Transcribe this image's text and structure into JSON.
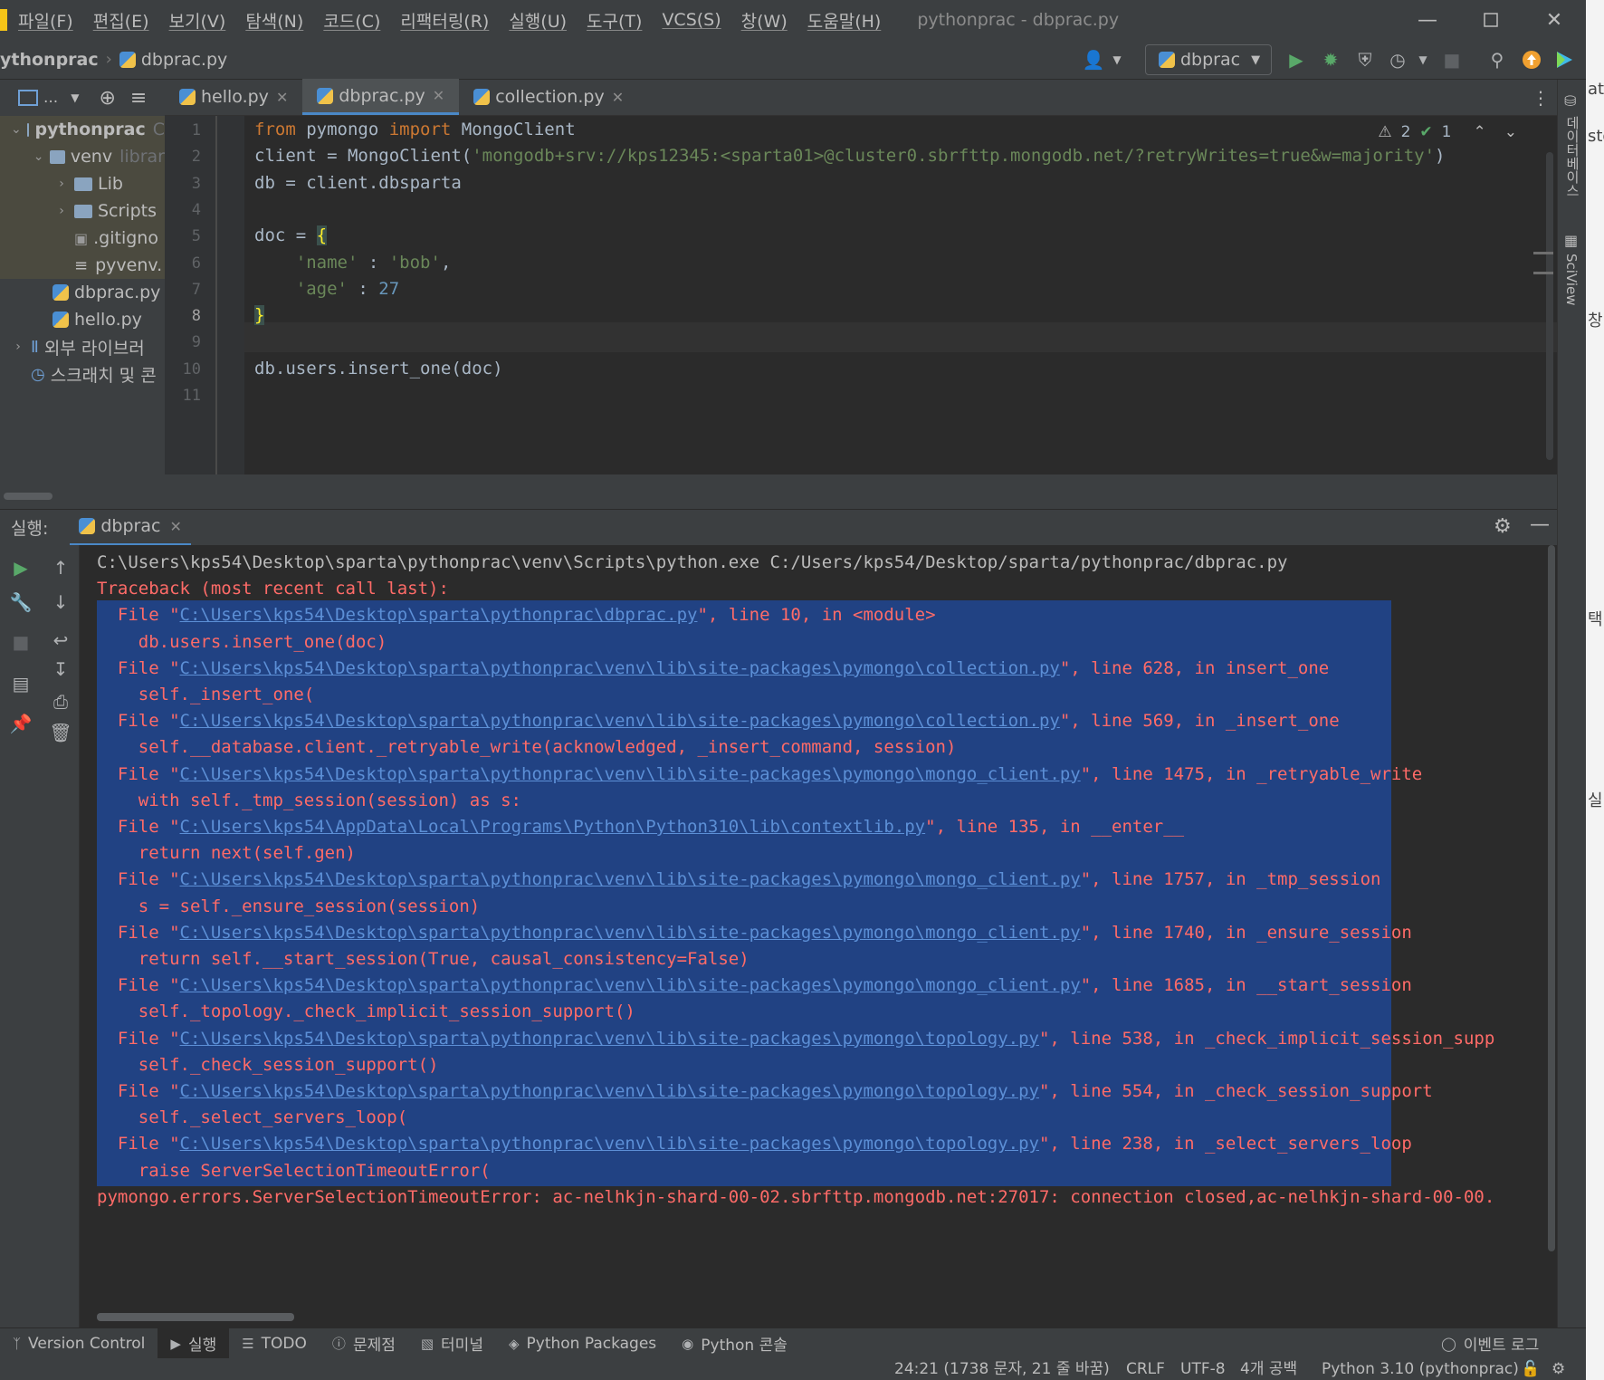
{
  "menu": {
    "items": [
      "파일(F)",
      "편집(E)",
      "보기(V)",
      "탐색(N)",
      "코드(C)",
      "리팩터링(R)",
      "실행(U)",
      "도구(T)",
      "VCS(S)",
      "창(W)",
      "도움말(H)"
    ],
    "window_title": "pythonprac - dbprac.py"
  },
  "navbar": {
    "project": "ythonprac",
    "file": "dbprac.py",
    "run_config": "dbprac"
  },
  "project_tree": [
    {
      "label": "pythonprac",
      "suffix": "C",
      "kind": "folder",
      "level": 0,
      "expanded": true,
      "bold": true
    },
    {
      "label": "venv",
      "suffix": "librar",
      "kind": "folder",
      "level": 1,
      "expanded": true
    },
    {
      "label": "Lib",
      "kind": "folder",
      "level": 2,
      "expanded": false
    },
    {
      "label": "Scripts",
      "kind": "folder",
      "level": 2,
      "expanded": false
    },
    {
      "label": ".gitigno",
      "kind": "file",
      "level": 2
    },
    {
      "label": "pyvenv.",
      "kind": "cfg",
      "level": 2
    },
    {
      "label": "dbprac.py",
      "kind": "py",
      "level": 1
    },
    {
      "label": "hello.py",
      "kind": "py",
      "level": 1
    },
    {
      "label": "외부 라이브러",
      "kind": "lib",
      "level": 0,
      "expanded": false
    },
    {
      "label": "스크래치 및 콘",
      "kind": "scratch",
      "level": 0
    }
  ],
  "editor_tabs": [
    {
      "label": "hello.py",
      "active": false
    },
    {
      "label": "dbprac.py",
      "active": true
    },
    {
      "label": "collection.py",
      "active": false
    }
  ],
  "inspections": {
    "warnings": "2",
    "ok": "1"
  },
  "code_lines": [
    {
      "n": "1",
      "html": "<span class='kw'>from</span> pymongo <span class='kw'>import</span> MongoClient"
    },
    {
      "n": "2",
      "html": "client = MongoClient(<span class='str'>'mongodb+srv://kps12345:&lt;sparta01&gt;@cluster0.sbrfttp.mongodb.net/?retryWrites=true&amp;w=majority'</span>)"
    },
    {
      "n": "3",
      "html": "db = client.dbsparta"
    },
    {
      "n": "4",
      "html": ""
    },
    {
      "n": "5",
      "html": "doc = <span class='brace'>{</span>"
    },
    {
      "n": "6",
      "html": "    <span class='str'>'name'</span> : <span class='str'>'bob'</span>,"
    },
    {
      "n": "7",
      "html": "    <span class='str'>'age'</span> : <span class='num'>27</span>"
    },
    {
      "n": "8",
      "html": "<span class='brace'>}</span>"
    },
    {
      "n": "9",
      "html": ""
    },
    {
      "n": "10",
      "html": "db.users.insert_one(doc)"
    },
    {
      "n": "11",
      "html": ""
    }
  ],
  "run_panel": {
    "label": "실행:",
    "tab": "dbprac"
  },
  "console": {
    "command": "C:\\Users\\kps54\\Desktop\\sparta\\pythonprac\\venv\\Scripts\\python.exe C:/Users/kps54/Desktop/sparta/pythonprac/dbprac.py",
    "traceback_header": "Traceback (most recent call last):",
    "frames": [
      {
        "path": "C:\\Users\\kps54\\Desktop\\sparta\\pythonprac\\dbprac.py",
        "tail": "\", line 10, in <module>",
        "code": "db.users.insert_one(doc)"
      },
      {
        "path": "C:\\Users\\kps54\\Desktop\\sparta\\pythonprac\\venv\\lib\\site-packages\\pymongo\\collection.py",
        "tail": "\", line 628, in insert_one",
        "code": "self._insert_one("
      },
      {
        "path": "C:\\Users\\kps54\\Desktop\\sparta\\pythonprac\\venv\\lib\\site-packages\\pymongo\\collection.py",
        "tail": "\", line 569, in _insert_one",
        "code": "self.__database.client._retryable_write(acknowledged, _insert_command, session)"
      },
      {
        "path": "C:\\Users\\kps54\\Desktop\\sparta\\pythonprac\\venv\\lib\\site-packages\\pymongo\\mongo_client.py",
        "tail": "\", line 1475, in _retryable_write",
        "code": "with self._tmp_session(session) as s:"
      },
      {
        "path": "C:\\Users\\kps54\\AppData\\Local\\Programs\\Python\\Python310\\lib\\contextlib.py",
        "tail": "\", line 135, in __enter__",
        "code": "return next(self.gen)"
      },
      {
        "path": "C:\\Users\\kps54\\Desktop\\sparta\\pythonprac\\venv\\lib\\site-packages\\pymongo\\mongo_client.py",
        "tail": "\", line 1757, in _tmp_session",
        "code": "s = self._ensure_session(session)"
      },
      {
        "path": "C:\\Users\\kps54\\Desktop\\sparta\\pythonprac\\venv\\lib\\site-packages\\pymongo\\mongo_client.py",
        "tail": "\", line 1740, in _ensure_session",
        "code": "return self.__start_session(True, causal_consistency=False)"
      },
      {
        "path": "C:\\Users\\kps54\\Desktop\\sparta\\pythonprac\\venv\\lib\\site-packages\\pymongo\\mongo_client.py",
        "tail": "\", line 1685, in __start_session",
        "code": "self._topology._check_implicit_session_support()"
      },
      {
        "path": "C:\\Users\\kps54\\Desktop\\sparta\\pythonprac\\venv\\lib\\site-packages\\pymongo\\topology.py",
        "tail": "\", line 538, in _check_implicit_session_supp",
        "code": "self._check_session_support()"
      },
      {
        "path": "C:\\Users\\kps54\\Desktop\\sparta\\pythonprac\\venv\\lib\\site-packages\\pymongo\\topology.py",
        "tail": "\", line 554, in _check_session_support",
        "code": "self._select_servers_loop("
      },
      {
        "path": "C:\\Users\\kps54\\Desktop\\sparta\\pythonprac\\venv\\lib\\site-packages\\pymongo\\topology.py",
        "tail": "\", line 238, in _select_servers_loop",
        "code": "raise ServerSelectionTimeoutError("
      }
    ],
    "error": "pymongo.errors.ServerSelectionTimeoutError: ac-nelhkjn-shard-00-02.sbrfttp.mongodb.net:27017: connection closed,ac-nelhkjn-shard-00-00."
  },
  "toolwindows": [
    "Version Control",
    "실행",
    "TODO",
    "문제점",
    "터미널",
    "Python Packages",
    "Python 콘솔"
  ],
  "event_log": "이벤트 로그",
  "status": {
    "position": "24:21 (1738 문자, 21 줄 바꿈)",
    "line_sep": "CRLF",
    "encoding": "UTF-8",
    "indent": "4개 공백",
    "interpreter": "Python 3.10 (pythonprac)"
  },
  "right_strip": {
    "db_label": "데이터베이스",
    "sciview_label": "SciView"
  },
  "outer_fragments": [
    "at",
    "sto",
    "창",
    "택)",
    "실"
  ]
}
